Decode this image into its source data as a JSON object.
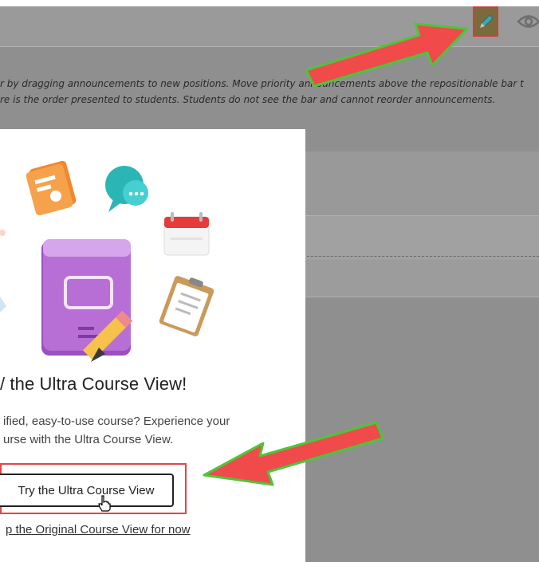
{
  "toolbar": {
    "edit_icon": "pencil-icon",
    "preview_icon": "eye-icon"
  },
  "instructions": {
    "line1": "r by dragging announcements to new positions. Move priority announcements above the repositionable bar t",
    "line2": "re is the order presented to students. Students do not see the bar and cannot reorder announcements."
  },
  "modal": {
    "title": "/ the Ultra Course View!",
    "desc_line1": "ified, easy-to-use course? Experience your",
    "desc_line2": "urse with the Ultra Course View.",
    "try_button": "Try the Ultra Course View",
    "keep_link": "p the Original Course View for now"
  },
  "colors": {
    "overlay": "#8f8f8f",
    "highlight_border": "#e24646",
    "annotation_arrow": "#f04a4a",
    "arrow_outline": "#4cc63a",
    "book": "#b76fd6"
  }
}
